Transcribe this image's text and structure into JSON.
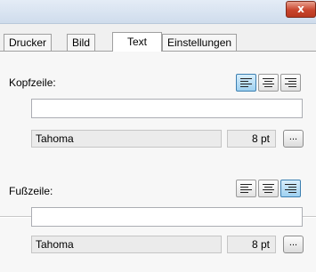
{
  "window": {
    "close_label": "x"
  },
  "tabs": [
    {
      "label": "Drucker",
      "active": false
    },
    {
      "label": "Bild",
      "active": false
    },
    {
      "label": "Text",
      "active": true
    },
    {
      "label": "Einstellungen",
      "active": false
    }
  ],
  "header_section": {
    "label": "Kopfzeile:",
    "alignment": "left",
    "text_value": "",
    "font_name": "Tahoma",
    "font_size": "8 pt",
    "font_button_label": "..."
  },
  "footer_section": {
    "label": "Fußzeile:",
    "alignment": "right",
    "text_value": "",
    "font_name": "Tahoma",
    "font_size": "8 pt",
    "font_button_label": "..."
  },
  "colors": {
    "active_align_bg": "#9fd1f1",
    "close_button": "#c9452d"
  }
}
